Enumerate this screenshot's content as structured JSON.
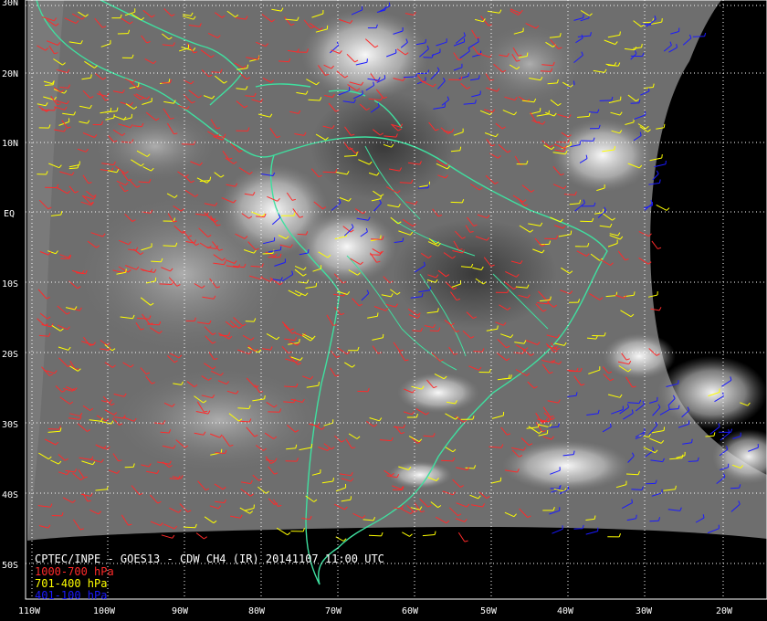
{
  "title": "CPTEC/INPE - GOES13 - CDW CH4 (IR) 20141107 11:00 UTC",
  "lat_labels": [
    "30N",
    "20N",
    "10N",
    "EQ",
    "10S",
    "20S",
    "30S",
    "40S",
    "50S"
  ],
  "lon_labels": [
    "110W",
    "100W",
    "90W",
    "80W",
    "70W",
    "60W",
    "50W",
    "40W",
    "30W",
    "20W"
  ],
  "legend": [
    {
      "label": "1000-700 hPa",
      "color": "#ff2a2a"
    },
    {
      "label": "701-400 hPa",
      "color": "#ffff00"
    },
    {
      "label": "401-100 hPa",
      "color": "#1a1aff"
    }
  ],
  "colors": {
    "coast": "#3fe0a0",
    "grid": "#ffffff",
    "space": "#000000"
  }
}
